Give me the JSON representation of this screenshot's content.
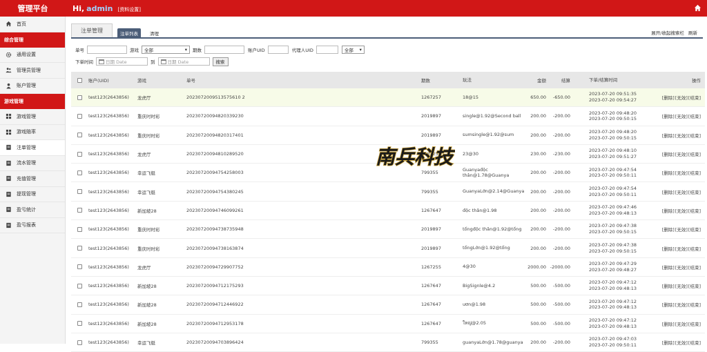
{
  "topbar": {
    "brand": "管理平台",
    "greeting": "Hi,",
    "username": "admin",
    "profile_link": "[资料设置]",
    "home_icon": "home-icon"
  },
  "sidebar": {
    "home": "首页",
    "section1": "综合管理",
    "items1": [
      {
        "label": "通用设置",
        "icon": "gear-icon"
      },
      {
        "label": "管理员管理",
        "icon": "users-icon"
      },
      {
        "label": "账户管理",
        "icon": "user-icon"
      }
    ],
    "section2": "游戏管理",
    "items2": [
      {
        "label": "游戏管理",
        "icon": "grid-icon"
      },
      {
        "label": "游戏赔率",
        "icon": "grid-icon"
      },
      {
        "label": "注单管理",
        "icon": "doc-icon"
      },
      {
        "label": "流水管理",
        "icon": "doc-icon"
      },
      {
        "label": "充值管理",
        "icon": "doc-icon"
      },
      {
        "label": "提现管理",
        "icon": "doc-icon"
      },
      {
        "label": "盈亏统计",
        "icon": "doc-icon"
      },
      {
        "label": "盈亏报表",
        "icon": "doc-icon"
      }
    ]
  },
  "tabs": {
    "main": "注单管理",
    "sub_active": "注单列表",
    "sub_other": "清理",
    "links": [
      "展开/收起搜索栏",
      "刷新"
    ]
  },
  "filter": {
    "order_no_label": "单号",
    "game_label": "游戏",
    "game_value": "全部",
    "period_label": "期数",
    "uid_label": "账户UID",
    "agent_uid_label": "代理人UID",
    "agent_select_value": "全部",
    "time_label": "下单时间",
    "date_from_placeholder": "日期 Date",
    "to_label": "到",
    "date_to_placeholder": "日期 Date",
    "search_button": "搜索"
  },
  "table": {
    "headers": [
      "账户(UID)",
      "游戏",
      "单号",
      "期数",
      "玩法",
      "金额",
      "结算",
      "下单/结算时间",
      "操作"
    ],
    "actions": [
      "[删除]",
      "[无效]",
      "[结束]"
    ],
    "rows": [
      {
        "account": "test123(2643856)",
        "game": "龙虎厅",
        "order_no": "2023072009513575610 2",
        "period": "1267257",
        "play": "18@15",
        "amount": "650.00",
        "settle": "-650.00",
        "t1": "2023-07-20 09:51:35",
        "t2": "2023-07-20 09:54:27"
      },
      {
        "account": "test123(2643856)",
        "game": "重庆时时彩",
        "order_no": "20230720094820339230",
        "period": "2019897",
        "play": "single@1.92@Second ball",
        "amount": "200.00",
        "settle": "-200.00",
        "t1": "2023-07-20 09:48:20",
        "t2": "2023-07-20 09:50:15"
      },
      {
        "account": "test123(2643856)",
        "game": "重庆时时彩",
        "order_no": "20230720094820317401",
        "period": "2019897",
        "play": "sumsingle@1.92@sum",
        "amount": "200.00",
        "settle": "-200.00",
        "t1": "2023-07-20 09:48:20",
        "t2": "2023-07-20 09:50:15"
      },
      {
        "account": "test123(2643856)",
        "game": "龙虎厅",
        "order_no": "20230720094810289520",
        "period": "1267256",
        "play": "23@30",
        "amount": "230.00",
        "settle": "-230.00",
        "t1": "2023-07-20 09:48:10",
        "t2": "2023-07-20 09:51:27"
      },
      {
        "account": "test123(2643856)",
        "game": "幸运飞艇",
        "order_no": "20230720094754258003",
        "period": "799355",
        "play": "Guanyađộc thân@1.78@Guanya",
        "amount": "200.00",
        "settle": "-200.00",
        "t1": "2023-07-20 09:47:54",
        "t2": "2023-07-20 09:50:11"
      },
      {
        "account": "test123(2643856)",
        "game": "幸运飞艇",
        "order_no": "20230720094754380245",
        "period": "799355",
        "play": "GuanyaLớn@2.14@Guanya",
        "amount": "200.00",
        "settle": "-200.00",
        "t1": "2023-07-20 09:47:54",
        "t2": "2023-07-20 09:50:11"
      },
      {
        "account": "test123(2643856)",
        "game": "新加坡28",
        "order_no": "20230720094746099261",
        "period": "1267647",
        "play": "độc thân@1.98",
        "amount": "200.00",
        "settle": "-200.00",
        "t1": "2023-07-20 09:47:46",
        "t2": "2023-07-20 09:48:13"
      },
      {
        "account": "test123(2643856)",
        "game": "重庆时时彩",
        "order_no": "20230720094738735948",
        "period": "2019897",
        "play": "tổngđộc thân@1.92@tổng",
        "amount": "200.00",
        "settle": "-200.00",
        "t1": "2023-07-20 09:47:38",
        "t2": "2023-07-20 09:50:15"
      },
      {
        "account": "test123(2643856)",
        "game": "重庆时时彩",
        "order_no": "20230720094738163874",
        "period": "2019897",
        "play": "tổngLớn@1.92@tổng",
        "amount": "200.00",
        "settle": "-200.00",
        "t1": "2023-07-20 09:47:38",
        "t2": "2023-07-20 09:50:15"
      },
      {
        "account": "test123(2643856)",
        "game": "龙虎厅",
        "order_no": "20230720094729907752",
        "period": "1267255",
        "play": "4@30",
        "amount": "2000.00",
        "settle": "-2000.00",
        "t1": "2023-07-20 09:47:29",
        "t2": "2023-07-20 09:48:27"
      },
      {
        "account": "test123(2643856)",
        "game": "新加坡28",
        "order_no": "20230720094712175293",
        "period": "1267647",
        "play": "BigSignle@4.2",
        "amount": "500.00",
        "settle": "-500.00",
        "t1": "2023-07-20 09:47:12",
        "t2": "2023-07-20 09:48:13"
      },
      {
        "account": "test123(2643856)",
        "game": "新加坡28",
        "order_no": "20230720094712446922",
        "period": "1267647",
        "play": "ươn@1.98",
        "amount": "500.00",
        "settle": "-500.00",
        "t1": "2023-07-20 09:47:12",
        "t2": "2023-07-20 09:48:13"
      },
      {
        "account": "test123(2643856)",
        "game": "新加坡28",
        "order_no": "20230720094712953178",
        "period": "1267647",
        "play": "ใหญ่@2.05",
        "amount": "500.00",
        "settle": "-500.00",
        "t1": "2023-07-20 09:47:12",
        "t2": "2023-07-20 09:48:13"
      },
      {
        "account": "test123(2643856)",
        "game": "幸运飞艇",
        "order_no": "20230720094703896424",
        "period": "799355",
        "play": "guanyaLớn@1.78@guanya",
        "amount": "200.00",
        "settle": "-200.00",
        "t1": "2023-07-20 09:47:03",
        "t2": "2023-07-20 09:50:11"
      }
    ]
  },
  "watermark": {
    "text": "南兵科技"
  },
  "colors": {
    "brand_red": "#d11717",
    "tab_blue": "#4b5d78",
    "highlight_row": "#f7fbe8"
  }
}
